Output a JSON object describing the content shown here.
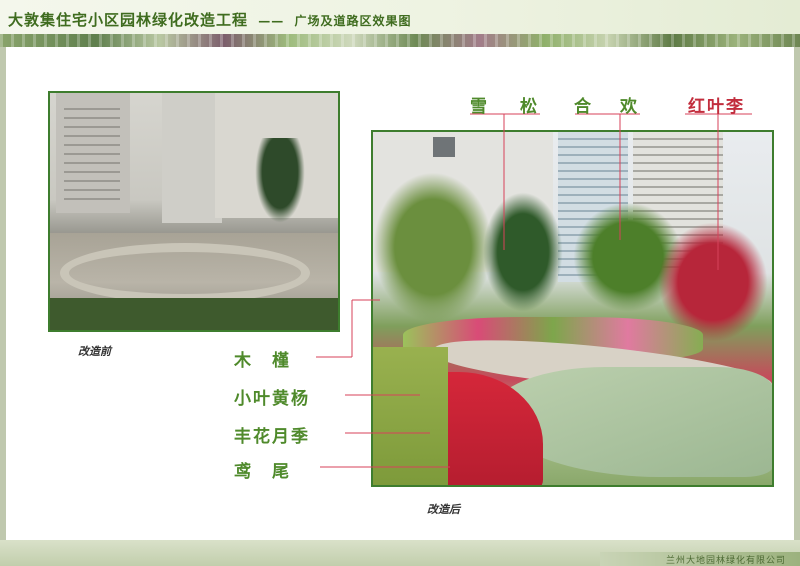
{
  "header": {
    "title": "大敦集住宅小区园林绿化改造工程",
    "separator": "——",
    "subtitle": "广场及道路区效果图"
  },
  "photos": {
    "before_caption": "改造前",
    "after_caption": "改造后"
  },
  "plant_labels_top": [
    {
      "label": "雪",
      "color": "#4f8a2b"
    },
    {
      "label": "松",
      "color": "#4f8a2b"
    },
    {
      "label": "合",
      "color": "#4f8a2b"
    },
    {
      "label": "欢",
      "color": "#4f8a2b"
    },
    {
      "label": "红叶李",
      "color": "#c22d3d"
    }
  ],
  "plant_labels_left": [
    {
      "label": "木　槿"
    },
    {
      "label": "小叶黄杨"
    },
    {
      "label": "丰花月季"
    },
    {
      "label": "鸢　尾"
    }
  ],
  "footer": {
    "company": "兰州大地园林绿化有限公司"
  },
  "colors": {
    "title_green": "#3f6c1f",
    "label_green": "#4f8a2b",
    "label_red": "#c22d3d",
    "frame_green": "#3e7d2e",
    "leader_red": "#d7425a"
  }
}
